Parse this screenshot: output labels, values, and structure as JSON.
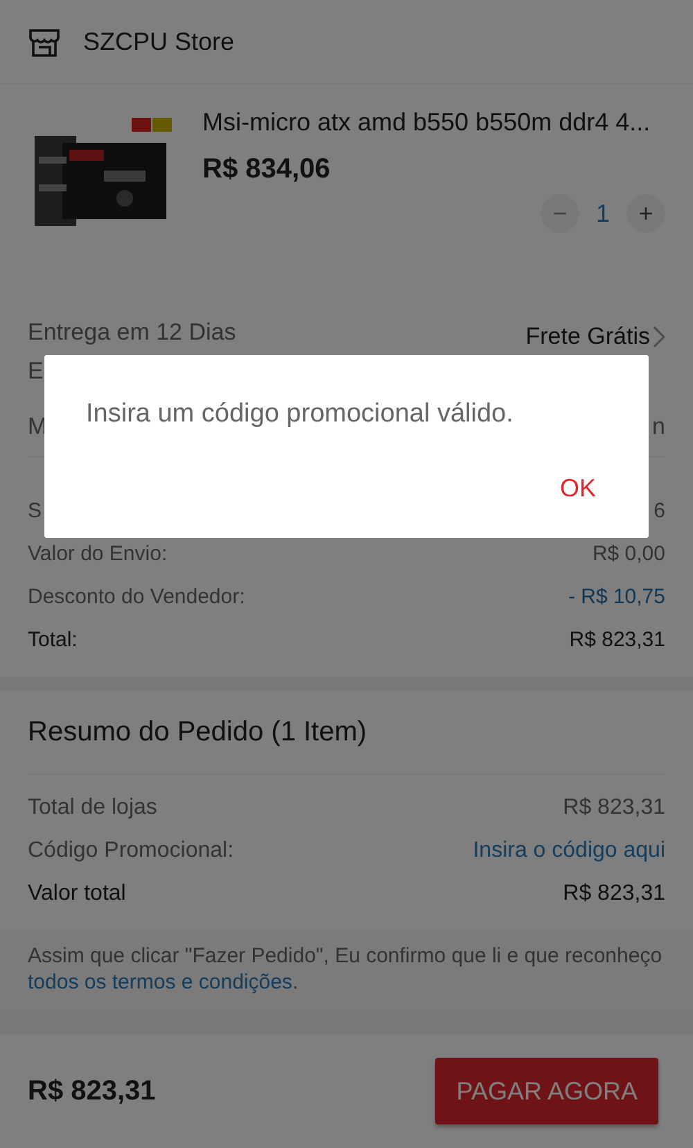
{
  "store": {
    "name": "SZCPU Store"
  },
  "product": {
    "title": "Msi-micro atx amd b550 b550m ddr4 4...",
    "price": "R$ 834,06",
    "quantity": "1",
    "decrease": {
      "label": "−",
      "disabled": true
    },
    "increase": {
      "label": "+",
      "disabled": false
    }
  },
  "shipping": {
    "delivery": "Entrega em 12 Dias",
    "estimate": "E",
    "method": "Frete Grátis"
  },
  "partial_row": {
    "label": "M",
    "value": "n"
  },
  "costs": [
    {
      "label": "S",
      "value": "6",
      "kind": "plain"
    },
    {
      "label": "Valor do Envio:",
      "value": "R$ 0,00",
      "kind": "plain"
    },
    {
      "label": "Desconto do Vendedor:",
      "value": "- R$ 10,75",
      "kind": "discount"
    },
    {
      "label": "Total:",
      "value": "R$ 823,31",
      "kind": "total"
    }
  ],
  "summary": {
    "title": "Resumo do Pedido (1 Item)",
    "rows": [
      {
        "label": "Total de lojas",
        "value": "R$ 823,31",
        "kind": "plain"
      },
      {
        "label": "Código Promocional:",
        "value": "Insira o código aqui",
        "kind": "link"
      },
      {
        "label": "Valor total",
        "value": "R$ 823,31",
        "kind": "total"
      }
    ]
  },
  "notice": {
    "text": "Assim que clicar \"Fazer Pedido\", Eu confirmo que li e que reconheço",
    "link": "todos os termos e condições",
    "end": "."
  },
  "footer": {
    "total": "R$ 823,31",
    "button": "PAGAR AGORA"
  },
  "dialog": {
    "message": "Insira um código promocional válido.",
    "button": "OK"
  }
}
